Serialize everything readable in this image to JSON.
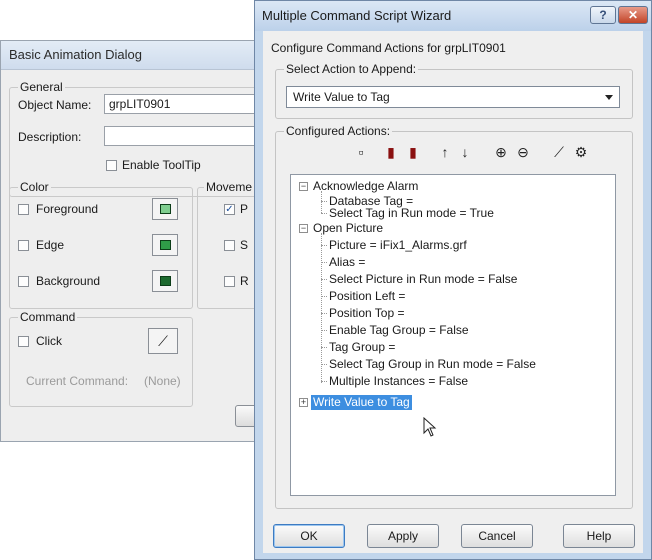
{
  "basic_dialog": {
    "title": "Basic Animation Dialog",
    "general": {
      "group_label": "General",
      "object_name_label": "Object Name:",
      "object_name_value": "grpLIT0901",
      "description_label": "Description:",
      "description_value": "",
      "enable_tooltip_label": "Enable ToolTip",
      "enable_tooltip_checked": false
    },
    "color": {
      "group_label": "Color",
      "foreground_label": "Foreground",
      "edge_label": "Edge",
      "background_label": "Background"
    },
    "movement": {
      "group_label": "Moveme",
      "items": [
        "P",
        "S",
        "R"
      ],
      "first_checked": true
    },
    "command": {
      "group_label": "Command",
      "click_label": "Click",
      "current_command_label": "Current Command:",
      "current_command_value": "(None)"
    }
  },
  "wizard": {
    "title": "Multiple Command Script Wizard",
    "help_glyph": "?",
    "close_glyph": "✕",
    "configure_label": "Configure Command Actions for grpLIT0901",
    "select_action_label": "Select Action to Append:",
    "selected_action": "Write Value to Tag",
    "configured_actions_label": "Configured Actions:",
    "toolbar_icons": [
      "new-action-icon",
      "delete-action-icon",
      "delete-all-icon",
      "move-up-icon",
      "move-down-icon",
      "expand-icon",
      "collapse-icon",
      "run-icon",
      "settings-icon"
    ],
    "tree": [
      {
        "label": "Acknowledge Alarm",
        "children": [
          "Database Tag =",
          "Select Tag in Run mode = True"
        ]
      },
      {
        "label": "Open Picture",
        "children": [
          "Picture = iFix1_Alarms.grf",
          "Alias =",
          "Select Picture in Run mode = False",
          "Position Left =",
          "Position Top =",
          "Enable Tag Group = False",
          "Tag Group =",
          "Select Tag Group in Run mode = False",
          "Multiple Instances = False"
        ]
      },
      {
        "label": "Write Value to Tag",
        "children": []
      }
    ],
    "buttons": {
      "ok": "OK",
      "apply": "Apply",
      "cancel": "Cancel",
      "help": "Help"
    }
  }
}
